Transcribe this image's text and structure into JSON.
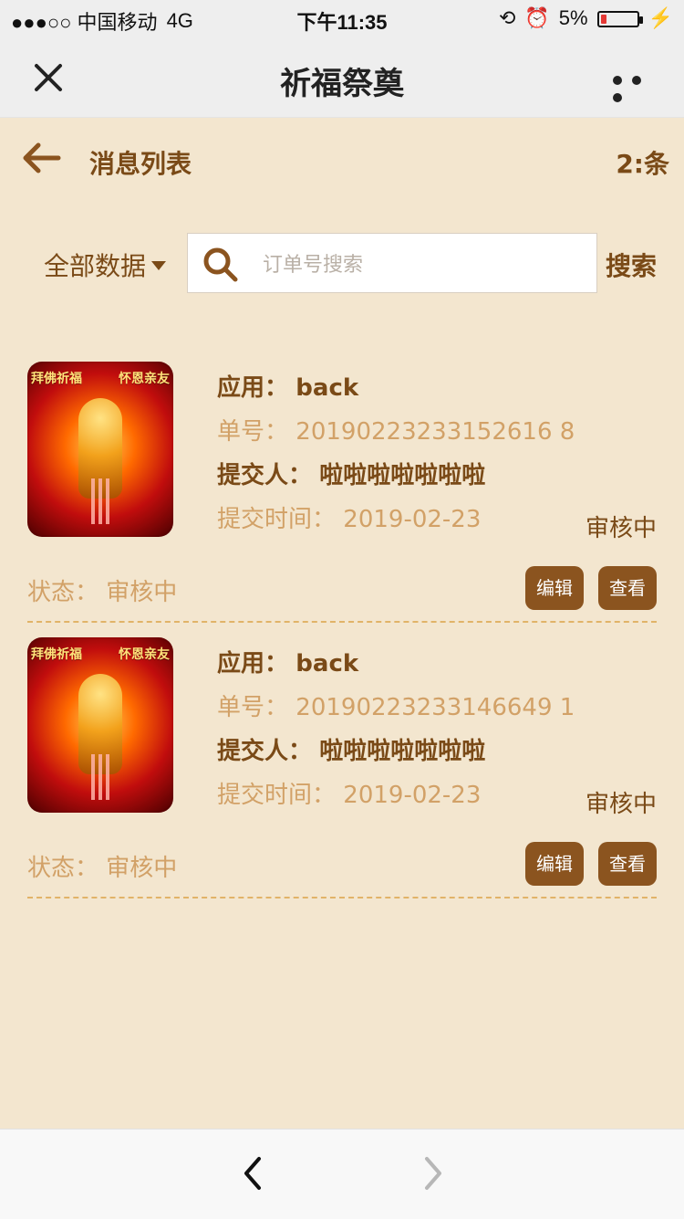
{
  "status_bar": {
    "carrier": "●●●○○ 中国移动",
    "network": "4G",
    "time": "下午11:35",
    "battery_percent": "5%"
  },
  "top_nav": {
    "title": "祈福祭奠"
  },
  "header": {
    "title": "消息列表",
    "count": "2:条"
  },
  "filter": {
    "label": "全部数据"
  },
  "search": {
    "placeholder": "订单号搜索",
    "button_label": "搜索"
  },
  "items": [
    {
      "thumbnail_text_left": "拜佛祈福",
      "thumbnail_text_right": "怀恩亲友",
      "app_label": "应用：",
      "app_value": "back",
      "order_label": "单号：",
      "order_value": "20190223233152616 8",
      "submitter_label": "提交人：",
      "submitter_value": "啦啦啦啦啦啦啦",
      "time_label": "提交时间：",
      "time_value": "2019-02-23",
      "right_status": "审核中",
      "status_label": "状态：",
      "status_value": "审核中",
      "edit_label": "编辑",
      "view_label": "查看"
    },
    {
      "thumbnail_text_left": "拜佛祈福",
      "thumbnail_text_right": "怀恩亲友",
      "app_label": "应用：",
      "app_value": "back",
      "order_label": "单号：",
      "order_value": "20190223233146649 1",
      "submitter_label": "提交人：",
      "submitter_value": "啦啦啦啦啦啦啦",
      "time_label": "提交时间：",
      "time_value": "2019-02-23",
      "right_status": "审核中",
      "status_label": "状态：",
      "status_value": "审核中",
      "edit_label": "编辑",
      "view_label": "查看"
    }
  ],
  "colors": {
    "background": "#f3e6cf",
    "primary_text": "#7a4a17",
    "soft_text": "#d2a167",
    "button_bg": "#8b541f",
    "divider": "#e1b368"
  }
}
